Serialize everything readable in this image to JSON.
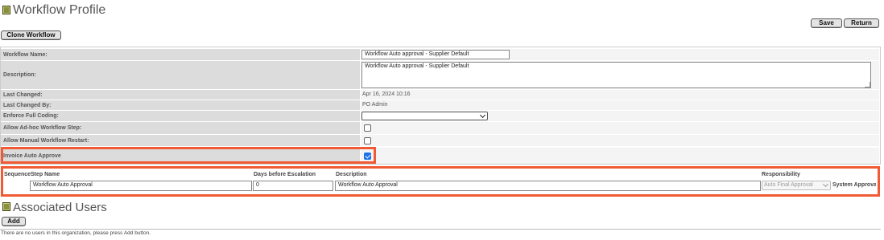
{
  "page": {
    "title": "Workflow Profile",
    "clone_button": "Clone Workflow",
    "save_button": "Save",
    "return_button": "Return"
  },
  "form": {
    "workflow_name_label": "Workflow Name:",
    "workflow_name_value": "Workflow Auto approval - Supplier Default",
    "description_label": "Description:",
    "description_value": "Workflow Auto approval - Supplier Default",
    "last_changed_label": "Last Changed:",
    "last_changed_value": "Apr 16, 2024 10:16",
    "last_changed_by_label": "Last Changed By:",
    "last_changed_by_value": "PO Admin",
    "enforce_full_coding_label": "Enforce Full Coding:",
    "enforce_full_coding_value": "",
    "allow_adhoc_label": "Allow Ad-hoc Workflow Step:",
    "allow_adhoc_checked": false,
    "allow_restart_label": "Allow Manual Workflow Restart:",
    "allow_restart_checked": false,
    "invoice_auto_approve_label": "Invoice Auto Approve",
    "invoice_auto_approve_checked": true
  },
  "steps_table": {
    "headers": {
      "sequence": "Sequence",
      "step_name": "Step Name",
      "days": "Days before Escalation",
      "description": "Description",
      "responsibility": "Responsibility"
    },
    "rows": [
      {
        "step_name": "Workflow Auto Approval",
        "days": "0",
        "description": "Workflow Auto Approval",
        "responsibility": "Auto Final Approval",
        "system_label": "System Approva"
      }
    ]
  },
  "associated_users": {
    "title": "Associated Users",
    "add_button": "Add",
    "empty_message": "There are no users in this organization, please press Add button."
  },
  "colors": {
    "highlight": "#f05a35",
    "label_bg": "#dcdcdc",
    "checkbox_checked": "#1a73e8"
  }
}
